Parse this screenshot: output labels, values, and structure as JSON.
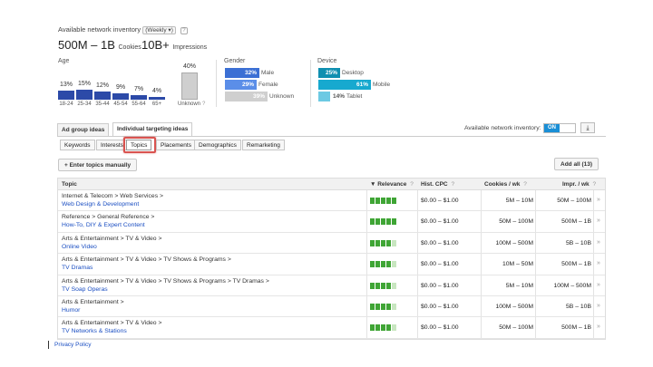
{
  "inventory": {
    "title": "Available network inventory",
    "period": "(Weekly ▾)",
    "help": "?",
    "cookies_value": "500M – 1B",
    "cookies_label": "Cookies",
    "impressions_value": "10B+",
    "impressions_label": "Impressions"
  },
  "age": {
    "label": "Age",
    "groups": [
      {
        "label": "18-24",
        "pct": "13%",
        "value": 13
      },
      {
        "label": "25-34",
        "pct": "15%",
        "value": 15
      },
      {
        "label": "35-44",
        "pct": "12%",
        "value": 12
      },
      {
        "label": "45-54",
        "pct": "9%",
        "value": 9
      },
      {
        "label": "55-64",
        "pct": "7%",
        "value": 7
      },
      {
        "label": "65+",
        "pct": "4%",
        "value": 4
      }
    ],
    "unknown": {
      "label": "Unknown",
      "pct": "40%",
      "value": 40,
      "help": "?"
    }
  },
  "gender": {
    "label": "Gender",
    "items": [
      {
        "label": "Male",
        "pct": "32%",
        "value": 32,
        "color": "#3b6fd4"
      },
      {
        "label": "Female",
        "pct": "29%",
        "value": 29,
        "color": "#5b8ee8"
      },
      {
        "label": "Unknown",
        "pct": "39%",
        "value": 39,
        "color": "#cfcfcf"
      }
    ]
  },
  "device": {
    "label": "Device",
    "items": [
      {
        "label": "Desktop",
        "pct": "25%",
        "value": 25,
        "color": "#0f8fb0"
      },
      {
        "label": "Mobile",
        "pct": "61%",
        "value": 61,
        "color": "#17a9cf"
      },
      {
        "label": "Tablet",
        "pct": "14%",
        "value": 14,
        "color": "#6cc9e3"
      }
    ]
  },
  "main_tabs": [
    "Ad group ideas",
    "Individual targeting ideas"
  ],
  "inventory_toggle": {
    "label": "Available network inventory:",
    "state": "ON"
  },
  "sub_tabs": [
    "Keywords",
    "Interests",
    "Topics",
    "Placements",
    "Demographics",
    "Remarketing"
  ],
  "enter_button": "+ Enter topics manually",
  "add_all_button": "Add all (13)",
  "table": {
    "headers": {
      "topic": "Topic",
      "relevance": "▼ Relevance",
      "cpc": "Hist. CPC",
      "cookies": "Cookies / wk",
      "impr": "Impr. / wk",
      "help": "?"
    },
    "rows": [
      {
        "path": "Internet & Telecom > Web Services >",
        "topic": "Web Design & Development",
        "relevance": 5,
        "cpc": "$0.00 – $1.00",
        "cookies": "5M – 10M",
        "impr": "50M – 100M"
      },
      {
        "path": "Reference > General Reference >",
        "topic": "How-To, DIY & Expert Content",
        "relevance": 5,
        "cpc": "$0.00 – $1.00",
        "cookies": "50M – 100M",
        "impr": "500M – 1B"
      },
      {
        "path": "Arts & Entertainment > TV & Video >",
        "topic": "Online Video",
        "relevance": 4,
        "cpc": "$0.00 – $1.00",
        "cookies": "100M – 500M",
        "impr": "5B – 10B"
      },
      {
        "path": "Arts & Entertainment > TV & Video > TV Shows & Programs >",
        "topic": "TV Dramas",
        "relevance": 4,
        "cpc": "$0.00 – $1.00",
        "cookies": "10M – 50M",
        "impr": "500M – 1B"
      },
      {
        "path": "Arts & Entertainment > TV & Video > TV Shows & Programs > TV Dramas >",
        "topic": "TV Soap Operas",
        "relevance": 4,
        "cpc": "$0.00 – $1.00",
        "cookies": "5M – 10M",
        "impr": "100M – 500M"
      },
      {
        "path": "Arts & Entertainment >",
        "topic": "Humor",
        "relevance": 4,
        "cpc": "$0.00 – $1.00",
        "cookies": "100M – 500M",
        "impr": "5B – 10B"
      },
      {
        "path": "Arts & Entertainment > TV & Video >",
        "topic": "TV Networks & Stations",
        "relevance": 4,
        "cpc": "$0.00 – $1.00",
        "cookies": "50M – 100M",
        "impr": "500M – 1B"
      }
    ]
  },
  "footer": {
    "privacy": "Privacy Policy"
  }
}
